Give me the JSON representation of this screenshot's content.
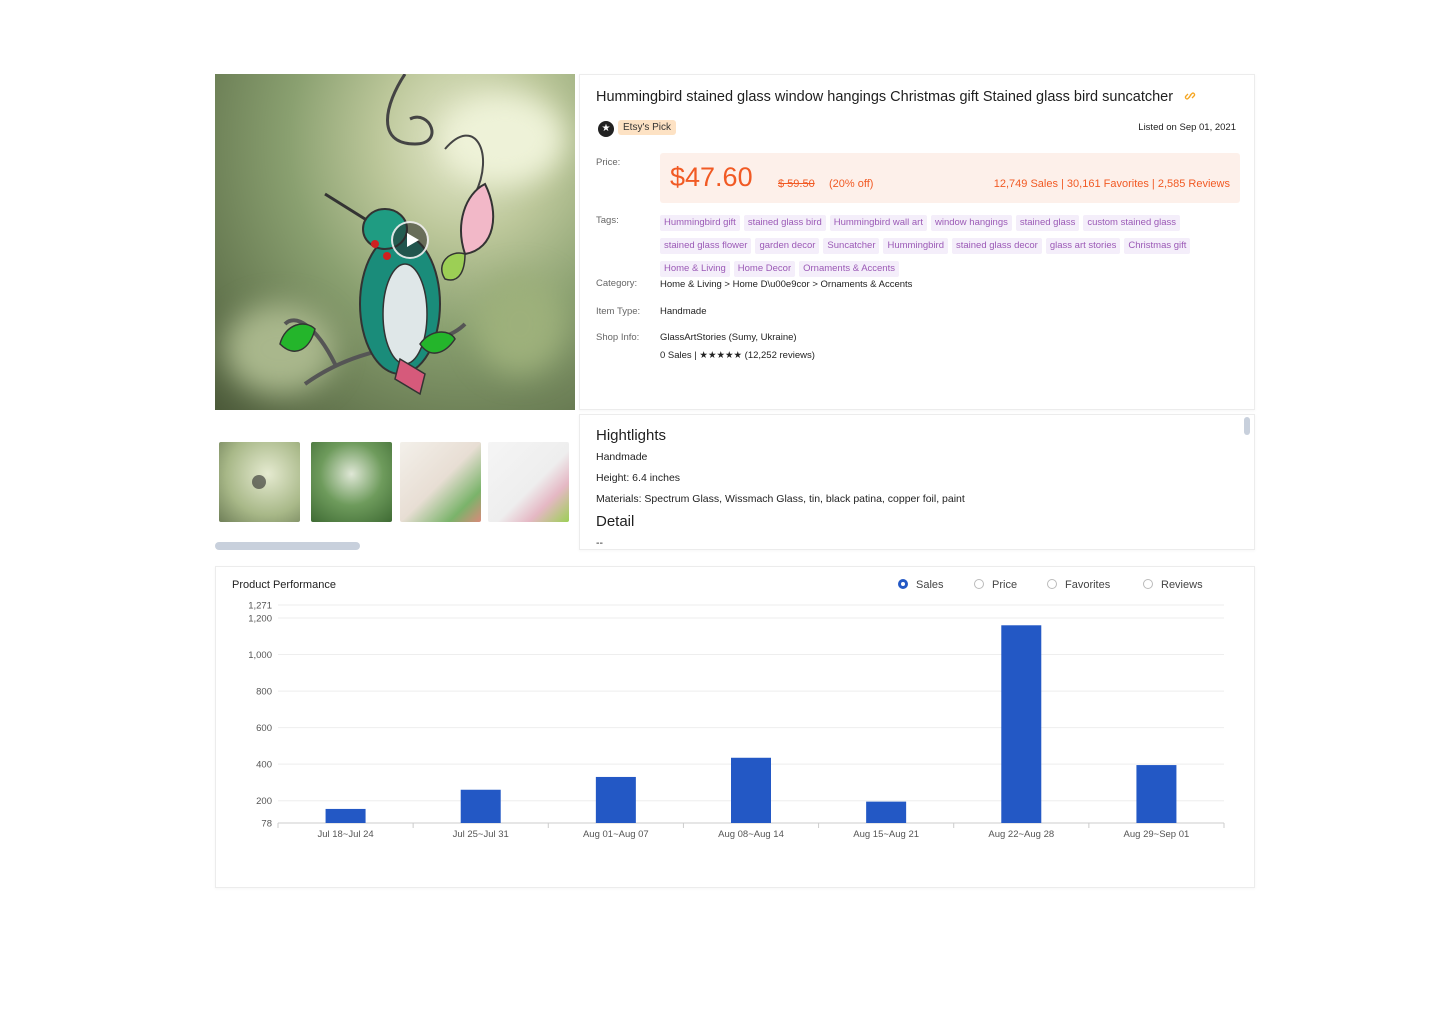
{
  "product": {
    "title": "Hummingbird stained glass window hangings Christmas gift Stained glass bird suncatcher",
    "badge": "Etsy's Pick",
    "listed_on": "Listed on Sep 01, 2021"
  },
  "labels": {
    "price": "Price:",
    "tags": "Tags:",
    "category": "Category:",
    "item_type": "Item Type:",
    "shop_info": "Shop Info:"
  },
  "price": {
    "current": "$47.60",
    "original": "$ 59.50",
    "discount": "(20% off)",
    "stats": "12,749 Sales | 30,161 Favorites | 2,585 Reviews"
  },
  "tags": [
    "Hummingbird gift",
    "stained glass bird",
    "Hummingbird wall art",
    "window hangings",
    "stained glass",
    "custom stained glass",
    "stained glass flower",
    "garden decor",
    "Suncatcher",
    "Hummingbird",
    "stained glass decor",
    "glass art stories",
    "Christmas gift",
    "Home & Living",
    "Home Decor",
    "Ornaments & Accents"
  ],
  "category": "Home & Living  > Home D\\u00e9cor > Ornaments & Accents",
  "item_type": "Handmade",
  "shop": {
    "name": "GlassArtStories (Sumy, Ukraine)",
    "stats": "0 Sales | ★★★★★ (12,252 reviews)"
  },
  "highlights": {
    "title": "Hightlights",
    "lines": [
      "Handmade",
      "Height: 6.4 inches",
      "Materials: Spectrum Glass, Wissmach Glass, tin, black patina, copper foil, paint"
    ],
    "detail_title": "Detail",
    "detail_value": "--"
  },
  "performance": {
    "title": "Product Performance",
    "options": [
      {
        "label": "Sales",
        "selected": true
      },
      {
        "label": "Price",
        "selected": false
      },
      {
        "label": "Favorites",
        "selected": false
      },
      {
        "label": "Reviews",
        "selected": false
      }
    ]
  },
  "colors": {
    "accent": "#f15a24",
    "bar": "#2358c5",
    "tag": "#9b59b6"
  },
  "chart_data": {
    "type": "bar",
    "categories": [
      "Jul 18~Jul 24",
      "Jul 25~Jul 31",
      "Aug 01~Aug 07",
      "Aug 08~Aug 14",
      "Aug 15~Aug 21",
      "Aug 22~Aug 28",
      "Aug 29~Sep 01"
    ],
    "values": [
      155,
      260,
      330,
      435,
      195,
      1160,
      395
    ],
    "yticks": [
      78,
      200,
      400,
      600,
      800,
      1000,
      1200,
      1271
    ],
    "ytick_labels": [
      "78",
      "200",
      "400",
      "600",
      "800",
      "1,000",
      "1,200",
      "1,271"
    ],
    "ylim": [
      78,
      1271
    ],
    "grid": true,
    "legend": "none"
  }
}
